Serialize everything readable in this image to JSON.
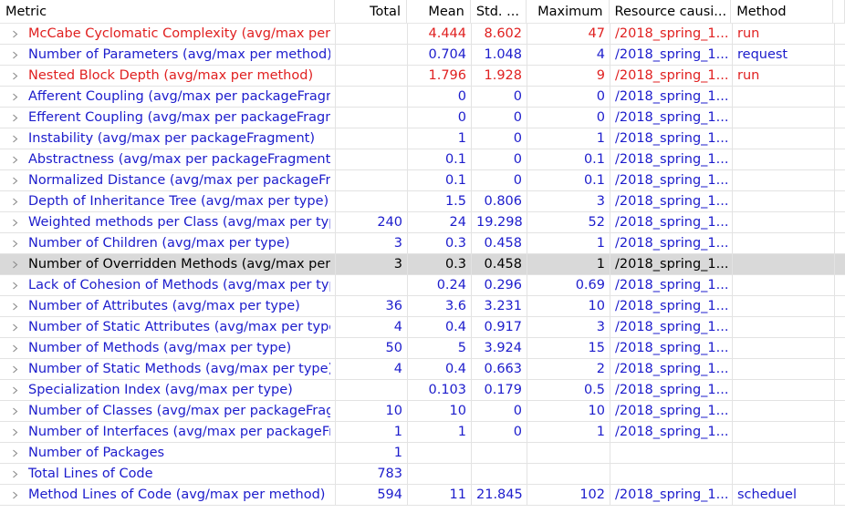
{
  "colors": {
    "normal": "#1c1ccc",
    "violation": "#e02020",
    "selected_text": "#000000"
  },
  "columns": [
    "Metric",
    "Total",
    "Mean",
    "Std. ...",
    "Maximum",
    "Resource causi...",
    "Method"
  ],
  "rows": [
    {
      "metric": "McCabe Cyclomatic Complexity (avg/max per method)",
      "total": "",
      "mean": "4.444",
      "std": "8.602",
      "max": "47",
      "resource": "/2018_spring_1...",
      "method": "run",
      "status": "violation"
    },
    {
      "metric": "Number of Parameters (avg/max per method)",
      "total": "",
      "mean": "0.704",
      "std": "1.048",
      "max": "4",
      "resource": "/2018_spring_1...",
      "method": "request",
      "status": "normal"
    },
    {
      "metric": "Nested Block Depth (avg/max per method)",
      "total": "",
      "mean": "1.796",
      "std": "1.928",
      "max": "9",
      "resource": "/2018_spring_1...",
      "method": "run",
      "status": "violation"
    },
    {
      "metric": "Afferent Coupling (avg/max per packageFragment)",
      "total": "",
      "mean": "0",
      "std": "0",
      "max": "0",
      "resource": "/2018_spring_1...",
      "method": "",
      "status": "normal"
    },
    {
      "metric": "Efferent Coupling (avg/max per packageFragment)",
      "total": "",
      "mean": "0",
      "std": "0",
      "max": "0",
      "resource": "/2018_spring_1...",
      "method": "",
      "status": "normal"
    },
    {
      "metric": "Instability (avg/max per packageFragment)",
      "total": "",
      "mean": "1",
      "std": "0",
      "max": "1",
      "resource": "/2018_spring_1...",
      "method": "",
      "status": "normal"
    },
    {
      "metric": "Abstractness (avg/max per packageFragment)",
      "total": "",
      "mean": "0.1",
      "std": "0",
      "max": "0.1",
      "resource": "/2018_spring_1...",
      "method": "",
      "status": "normal"
    },
    {
      "metric": "Normalized Distance (avg/max per packageFragment)",
      "total": "",
      "mean": "0.1",
      "std": "0",
      "max": "0.1",
      "resource": "/2018_spring_1...",
      "method": "",
      "status": "normal"
    },
    {
      "metric": "Depth of Inheritance Tree (avg/max per type)",
      "total": "",
      "mean": "1.5",
      "std": "0.806",
      "max": "3",
      "resource": "/2018_spring_1...",
      "method": "",
      "status": "normal"
    },
    {
      "metric": "Weighted methods per Class (avg/max per type)",
      "total": "240",
      "mean": "24",
      "std": "19.298",
      "max": "52",
      "resource": "/2018_spring_1...",
      "method": "",
      "status": "normal"
    },
    {
      "metric": "Number of Children (avg/max per type)",
      "total": "3",
      "mean": "0.3",
      "std": "0.458",
      "max": "1",
      "resource": "/2018_spring_1...",
      "method": "",
      "status": "normal"
    },
    {
      "metric": "Number of Overridden Methods (avg/max per type)",
      "total": "3",
      "mean": "0.3",
      "std": "0.458",
      "max": "1",
      "resource": "/2018_spring_1...",
      "method": "",
      "status": "selected"
    },
    {
      "metric": "Lack of Cohesion of Methods (avg/max per type)",
      "total": "",
      "mean": "0.24",
      "std": "0.296",
      "max": "0.69",
      "resource": "/2018_spring_1...",
      "method": "",
      "status": "normal"
    },
    {
      "metric": "Number of Attributes (avg/max per type)",
      "total": "36",
      "mean": "3.6",
      "std": "3.231",
      "max": "10",
      "resource": "/2018_spring_1...",
      "method": "",
      "status": "normal"
    },
    {
      "metric": "Number of Static Attributes (avg/max per type)",
      "total": "4",
      "mean": "0.4",
      "std": "0.917",
      "max": "3",
      "resource": "/2018_spring_1...",
      "method": "",
      "status": "normal"
    },
    {
      "metric": "Number of Methods (avg/max per type)",
      "total": "50",
      "mean": "5",
      "std": "3.924",
      "max": "15",
      "resource": "/2018_spring_1...",
      "method": "",
      "status": "normal"
    },
    {
      "metric": "Number of Static Methods (avg/max per type)",
      "total": "4",
      "mean": "0.4",
      "std": "0.663",
      "max": "2",
      "resource": "/2018_spring_1...",
      "method": "",
      "status": "normal"
    },
    {
      "metric": "Specialization Index (avg/max per type)",
      "total": "",
      "mean": "0.103",
      "std": "0.179",
      "max": "0.5",
      "resource": "/2018_spring_1...",
      "method": "",
      "status": "normal"
    },
    {
      "metric": "Number of Classes (avg/max per packageFragment)",
      "total": "10",
      "mean": "10",
      "std": "0",
      "max": "10",
      "resource": "/2018_spring_1...",
      "method": "",
      "status": "normal"
    },
    {
      "metric": "Number of Interfaces (avg/max per packageFragment)",
      "total": "1",
      "mean": "1",
      "std": "0",
      "max": "1",
      "resource": "/2018_spring_1...",
      "method": "",
      "status": "normal"
    },
    {
      "metric": "Number of Packages",
      "total": "1",
      "mean": "",
      "std": "",
      "max": "",
      "resource": "",
      "method": "",
      "status": "normal"
    },
    {
      "metric": "Total Lines of Code",
      "total": "783",
      "mean": "",
      "std": "",
      "max": "",
      "resource": "",
      "method": "",
      "status": "normal"
    },
    {
      "metric": "Method Lines of Code (avg/max per method)",
      "total": "594",
      "mean": "11",
      "std": "21.845",
      "max": "102",
      "resource": "/2018_spring_1...",
      "method": "scheduel",
      "status": "normal"
    }
  ]
}
